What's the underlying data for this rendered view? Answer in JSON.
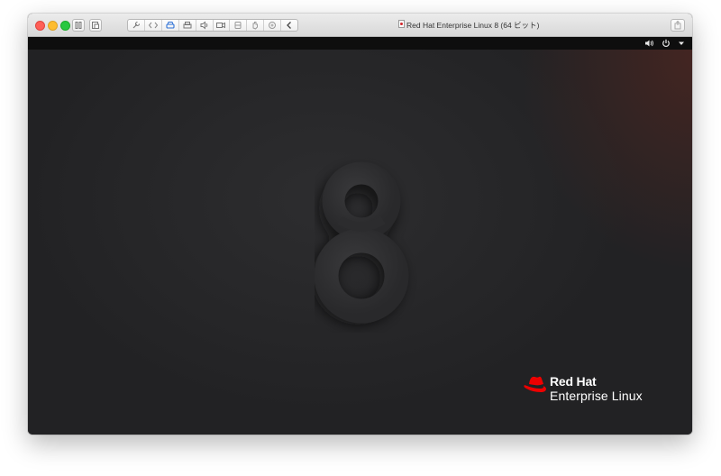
{
  "window": {
    "title": "Red Hat Enterprise Linux 8 (64 ビット)"
  },
  "toolbar": {
    "left_buttons": [
      "sidebar-toggle",
      "snapshot"
    ],
    "group_icons": [
      "wrench-icon",
      "code-icon",
      "hard-disk-icon",
      "printer-icon",
      "speaker-icon",
      "camera-icon",
      "usb-icon",
      "mouse-icon",
      "cd-icon",
      "chevron-left-icon"
    ]
  },
  "guest": {
    "tray_icons": [
      "volume-icon",
      "power-icon",
      "caret-down-icon"
    ],
    "splash_glyph": "8",
    "brand": {
      "name": "Red Hat",
      "product": "Enterprise Linux"
    },
    "colors": {
      "brand_red": "#ee0000",
      "background": "#242426"
    }
  }
}
